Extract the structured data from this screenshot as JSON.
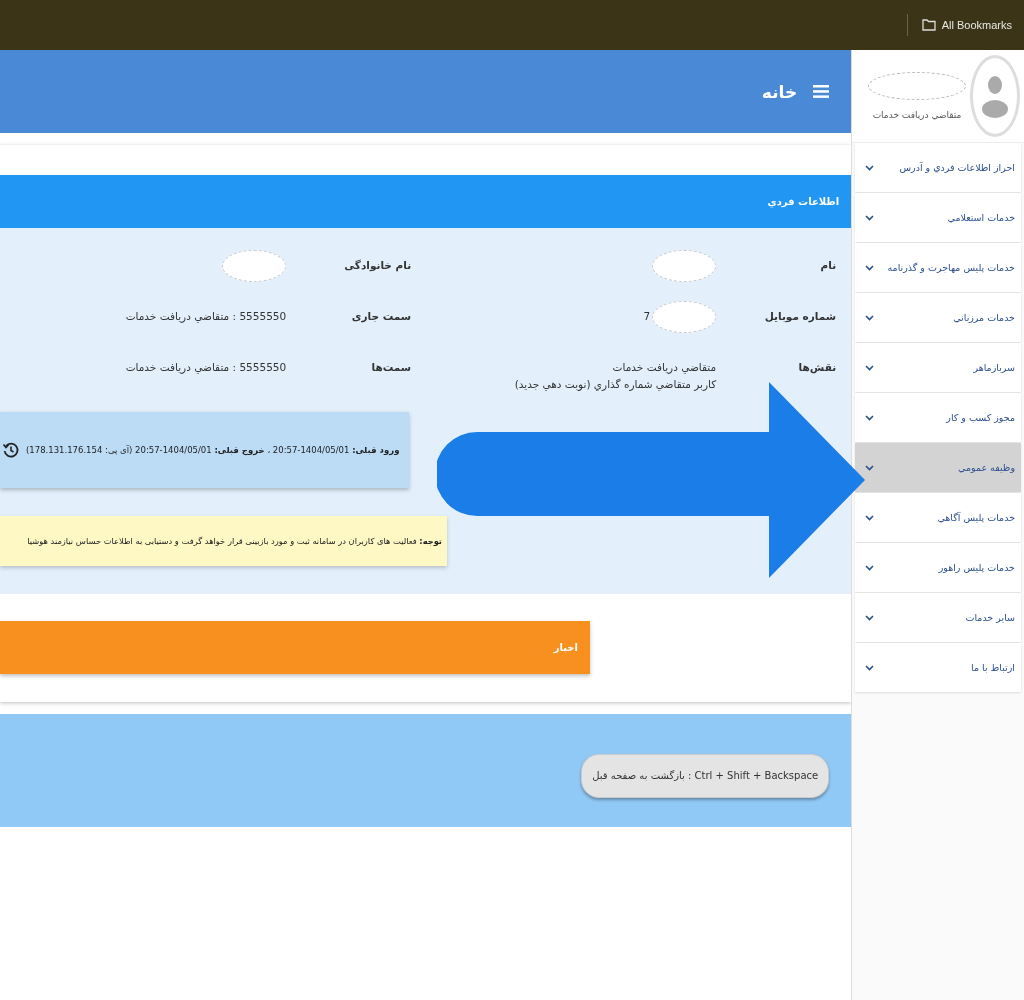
{
  "browser_bar": {
    "bookmarks_label": "All Bookmarks"
  },
  "header": {
    "title": "خانه"
  },
  "profile": {
    "role": "متقاضي دريافت خدمات"
  },
  "sidebar": {
    "items": [
      {
        "label": "احراز اطلاعات فردي و آدرس",
        "selected": false
      },
      {
        "label": "خدمات استعلامي",
        "selected": false
      },
      {
        "label": "خدمات پليس مهاجرت و گذرنامه",
        "selected": false
      },
      {
        "label": "خدمات مرزباني",
        "selected": false
      },
      {
        "label": "سربازماهر",
        "selected": false
      },
      {
        "label": "مجوز کسب و کار",
        "selected": false
      },
      {
        "label": "وظيفه عمومي",
        "selected": true
      },
      {
        "label": "خدمات پليس آگاهي",
        "selected": false
      },
      {
        "label": "خدمات پليس راهور",
        "selected": false
      },
      {
        "label": "ساير خدمات",
        "selected": false
      },
      {
        "label": "ارتباط با ما",
        "selected": false
      }
    ]
  },
  "personal_info": {
    "title": "اطلاعات فردي",
    "fields": [
      {
        "label": "نام",
        "redacted": true
      },
      {
        "label": "نام خانوادگی",
        "redacted": true
      },
      {
        "label": "شماره موبایل",
        "redacted": true,
        "values": [
          "7"
        ]
      },
      {
        "label": "سمت جاری",
        "redacted": false,
        "values": [
          "5555550 : متقاضي دريافت خدمات"
        ]
      },
      {
        "label": "نقش‌ها",
        "redacted": false,
        "values": [
          "متقاضي دريافت خدمات",
          "کاربر متقاضي شماره گذاري (نوبت دهي جديد)"
        ]
      },
      {
        "label": "سمت‌ها",
        "redacted": false,
        "values": [
          "5555550 : متقاضي دريافت خدمات"
        ]
      }
    ],
    "last_login": "**ورود قبلی:** 1404/05/01-20:57 ، **خروج قبلی:** 1404/05/01-20:57 (آی پی: 178.131.176.154)",
    "notice": "**توجه:** فعالیت های کاربران در سامانه ثبت و مورد بازبینی قرار خواهد گرفت و دستیابی به اطلاعات حساس نیازمند هوشیا"
  },
  "news": {
    "title": "اخبار"
  },
  "footer": {
    "shortcut_hint": "Ctrl + Shift + Backspace : بازگشت به صفحه قبل"
  }
}
